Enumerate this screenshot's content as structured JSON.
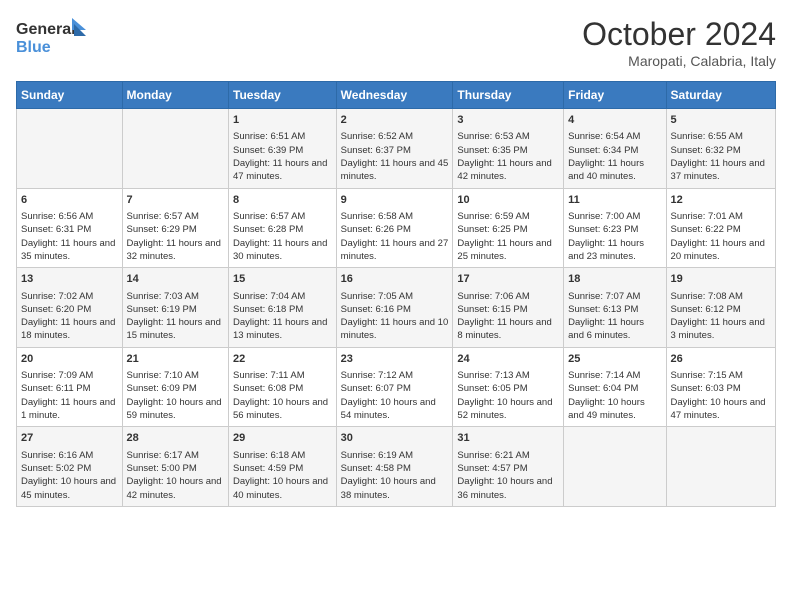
{
  "header": {
    "logo_line1": "General",
    "logo_line2": "Blue",
    "month": "October 2024",
    "location": "Maropati, Calabria, Italy"
  },
  "days_of_week": [
    "Sunday",
    "Monday",
    "Tuesday",
    "Wednesday",
    "Thursday",
    "Friday",
    "Saturday"
  ],
  "weeks": [
    [
      {
        "day": null,
        "content": ""
      },
      {
        "day": null,
        "content": ""
      },
      {
        "day": "1",
        "content": "Sunrise: 6:51 AM\nSunset: 6:39 PM\nDaylight: 11 hours and 47 minutes."
      },
      {
        "day": "2",
        "content": "Sunrise: 6:52 AM\nSunset: 6:37 PM\nDaylight: 11 hours and 45 minutes."
      },
      {
        "day": "3",
        "content": "Sunrise: 6:53 AM\nSunset: 6:35 PM\nDaylight: 11 hours and 42 minutes."
      },
      {
        "day": "4",
        "content": "Sunrise: 6:54 AM\nSunset: 6:34 PM\nDaylight: 11 hours and 40 minutes."
      },
      {
        "day": "5",
        "content": "Sunrise: 6:55 AM\nSunset: 6:32 PM\nDaylight: 11 hours and 37 minutes."
      }
    ],
    [
      {
        "day": "6",
        "content": "Sunrise: 6:56 AM\nSunset: 6:31 PM\nDaylight: 11 hours and 35 minutes."
      },
      {
        "day": "7",
        "content": "Sunrise: 6:57 AM\nSunset: 6:29 PM\nDaylight: 11 hours and 32 minutes."
      },
      {
        "day": "8",
        "content": "Sunrise: 6:57 AM\nSunset: 6:28 PM\nDaylight: 11 hours and 30 minutes."
      },
      {
        "day": "9",
        "content": "Sunrise: 6:58 AM\nSunset: 6:26 PM\nDaylight: 11 hours and 27 minutes."
      },
      {
        "day": "10",
        "content": "Sunrise: 6:59 AM\nSunset: 6:25 PM\nDaylight: 11 hours and 25 minutes."
      },
      {
        "day": "11",
        "content": "Sunrise: 7:00 AM\nSunset: 6:23 PM\nDaylight: 11 hours and 23 minutes."
      },
      {
        "day": "12",
        "content": "Sunrise: 7:01 AM\nSunset: 6:22 PM\nDaylight: 11 hours and 20 minutes."
      }
    ],
    [
      {
        "day": "13",
        "content": "Sunrise: 7:02 AM\nSunset: 6:20 PM\nDaylight: 11 hours and 18 minutes."
      },
      {
        "day": "14",
        "content": "Sunrise: 7:03 AM\nSunset: 6:19 PM\nDaylight: 11 hours and 15 minutes."
      },
      {
        "day": "15",
        "content": "Sunrise: 7:04 AM\nSunset: 6:18 PM\nDaylight: 11 hours and 13 minutes."
      },
      {
        "day": "16",
        "content": "Sunrise: 7:05 AM\nSunset: 6:16 PM\nDaylight: 11 hours and 10 minutes."
      },
      {
        "day": "17",
        "content": "Sunrise: 7:06 AM\nSunset: 6:15 PM\nDaylight: 11 hours and 8 minutes."
      },
      {
        "day": "18",
        "content": "Sunrise: 7:07 AM\nSunset: 6:13 PM\nDaylight: 11 hours and 6 minutes."
      },
      {
        "day": "19",
        "content": "Sunrise: 7:08 AM\nSunset: 6:12 PM\nDaylight: 11 hours and 3 minutes."
      }
    ],
    [
      {
        "day": "20",
        "content": "Sunrise: 7:09 AM\nSunset: 6:11 PM\nDaylight: 11 hours and 1 minute."
      },
      {
        "day": "21",
        "content": "Sunrise: 7:10 AM\nSunset: 6:09 PM\nDaylight: 10 hours and 59 minutes."
      },
      {
        "day": "22",
        "content": "Sunrise: 7:11 AM\nSunset: 6:08 PM\nDaylight: 10 hours and 56 minutes."
      },
      {
        "day": "23",
        "content": "Sunrise: 7:12 AM\nSunset: 6:07 PM\nDaylight: 10 hours and 54 minutes."
      },
      {
        "day": "24",
        "content": "Sunrise: 7:13 AM\nSunset: 6:05 PM\nDaylight: 10 hours and 52 minutes."
      },
      {
        "day": "25",
        "content": "Sunrise: 7:14 AM\nSunset: 6:04 PM\nDaylight: 10 hours and 49 minutes."
      },
      {
        "day": "26",
        "content": "Sunrise: 7:15 AM\nSunset: 6:03 PM\nDaylight: 10 hours and 47 minutes."
      }
    ],
    [
      {
        "day": "27",
        "content": "Sunrise: 6:16 AM\nSunset: 5:02 PM\nDaylight: 10 hours and 45 minutes."
      },
      {
        "day": "28",
        "content": "Sunrise: 6:17 AM\nSunset: 5:00 PM\nDaylight: 10 hours and 42 minutes."
      },
      {
        "day": "29",
        "content": "Sunrise: 6:18 AM\nSunset: 4:59 PM\nDaylight: 10 hours and 40 minutes."
      },
      {
        "day": "30",
        "content": "Sunrise: 6:19 AM\nSunset: 4:58 PM\nDaylight: 10 hours and 38 minutes."
      },
      {
        "day": "31",
        "content": "Sunrise: 6:21 AM\nSunset: 4:57 PM\nDaylight: 10 hours and 36 minutes."
      },
      {
        "day": null,
        "content": ""
      },
      {
        "day": null,
        "content": ""
      }
    ]
  ]
}
